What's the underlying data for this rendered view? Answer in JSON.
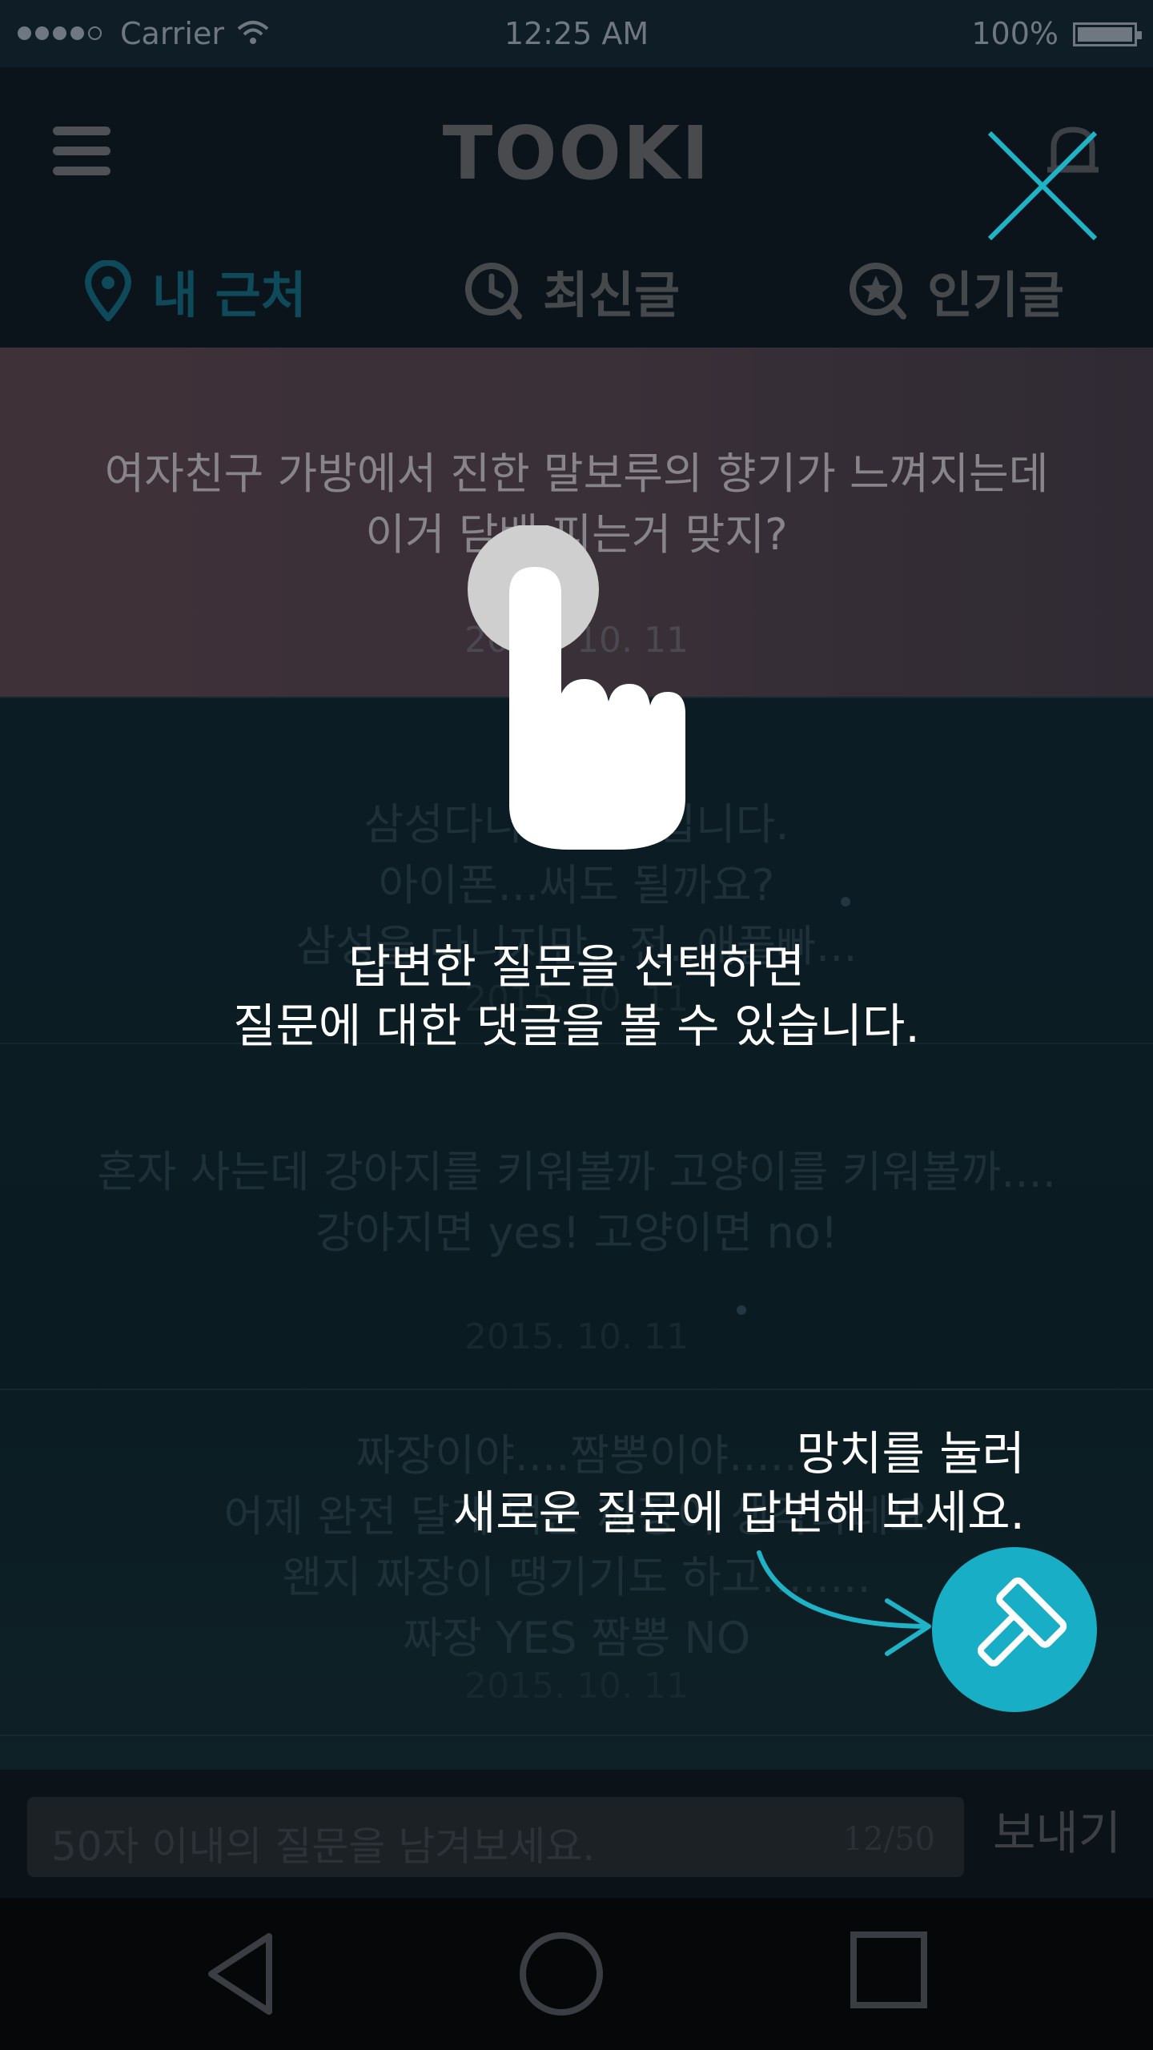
{
  "status_bar": {
    "carrier": "Carrier",
    "time": "12:25 AM",
    "battery": "100%",
    "battery_level": 1.0,
    "signal_bars": 4
  },
  "header": {
    "title": "TOOKI"
  },
  "tabs": [
    {
      "label": "내 근처",
      "icon": "location-pin-icon",
      "active": true
    },
    {
      "label": "최신글",
      "icon": "clock-icon",
      "active": false
    },
    {
      "label": "인기글",
      "icon": "star-icon",
      "active": false
    }
  ],
  "posts": [
    {
      "text": "여자친구 가방에서 진한 말보루의 향기가 느껴지는데\n이거 담배 피는거 맞지?",
      "date": "2015. 10. 11",
      "highlighted": true
    },
    {
      "text": "삼성다니는 직원입니다.\n아이폰...써도 될까요?\n삼성을 다니지만...전..애플빠...",
      "date": "2015. 10. 11"
    },
    {
      "text": "혼자 사는데 강아지를 키워볼까 고양이를 키워볼까....\n강아지면 yes! 고양이면 no!",
      "date": "2015. 10. 11"
    },
    {
      "text": "짜장이야....짬뽕이야.....\n어제 완전 달게 먹은 짜장이 생각나네요\n왠지 짜장이 땡기기도 하고........\n짜장 YES  짬뽕 NO",
      "date": "2015. 10. 11"
    }
  ],
  "composer": {
    "placeholder": "50자 이내의 질문을 남겨보세요.",
    "char_count": "12/50",
    "send_label": "보내기"
  },
  "tutorial": {
    "tip_select": "답변한 질문을 선택하면\n질문에 대한 댓글을 볼 수 있습니다.",
    "tip_hammer": "망치를 눌러\n새로운 질문에 답변해 보세요."
  },
  "colors": {
    "accent": "#18aec6",
    "close": "#1fb3c8",
    "overlay_text": "#ffffff"
  }
}
